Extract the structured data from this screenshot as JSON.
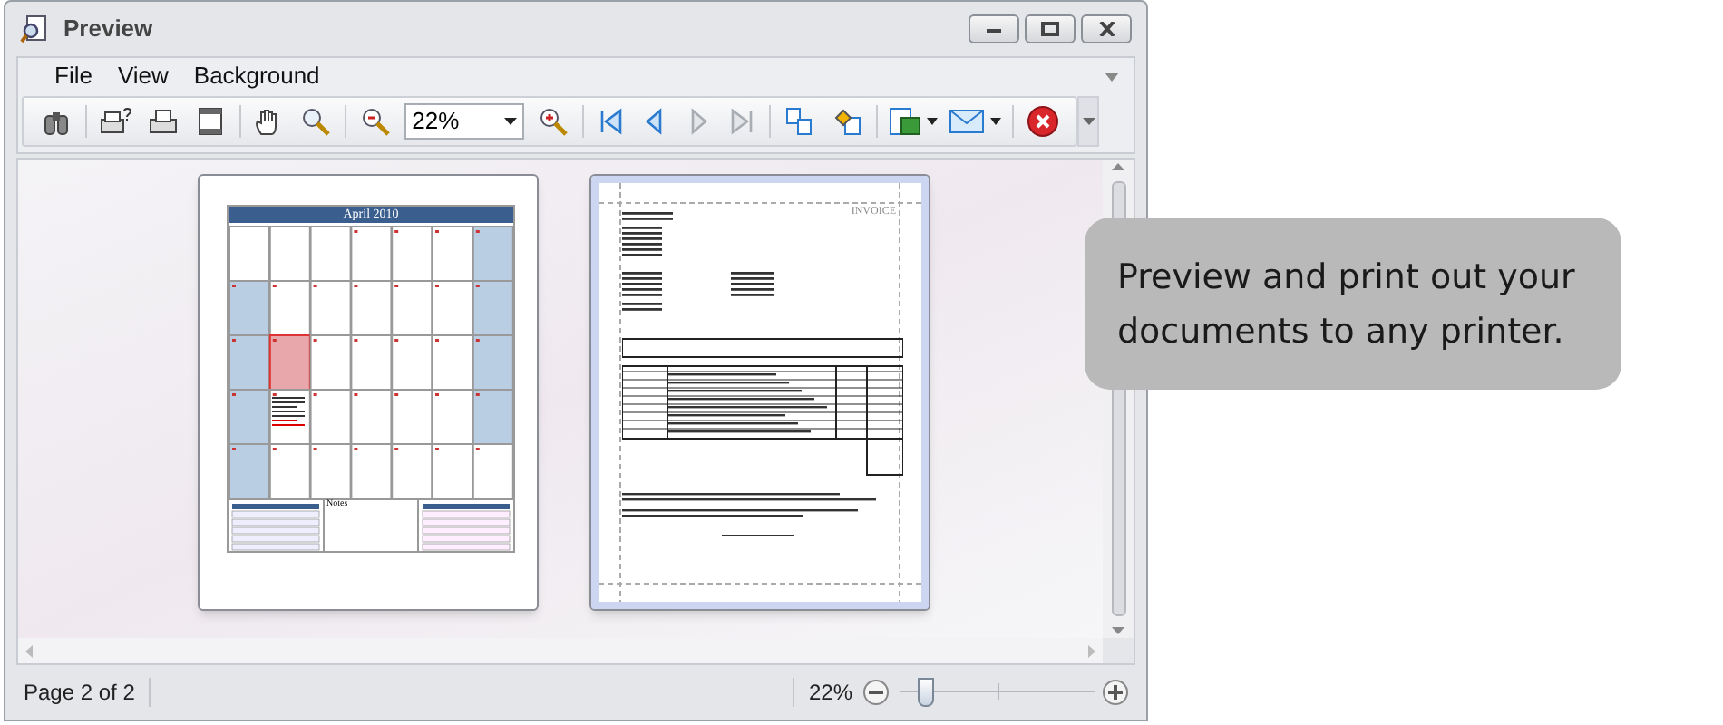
{
  "window": {
    "title": "Preview"
  },
  "menu": [
    "File",
    "View",
    "Background"
  ],
  "toolbar": {
    "zoom_value": "22%",
    "nav_buttons": [
      {
        "disabled": false
      },
      {
        "disabled": false
      },
      {
        "disabled": true
      },
      {
        "disabled": true
      }
    ]
  },
  "pages": [
    {
      "kind": "calendar",
      "selected": false,
      "title": "April 2010",
      "notes_label": "Notes"
    },
    {
      "kind": "invoice",
      "selected": true,
      "heading": "INVOICE"
    }
  ],
  "status_bar": {
    "page": "Page 2 of 2",
    "zoom": "22%",
    "zoom_slider": {
      "level": 0.1
    }
  },
  "callout": {
    "text": "Preview and print out your documents to any printer."
  }
}
